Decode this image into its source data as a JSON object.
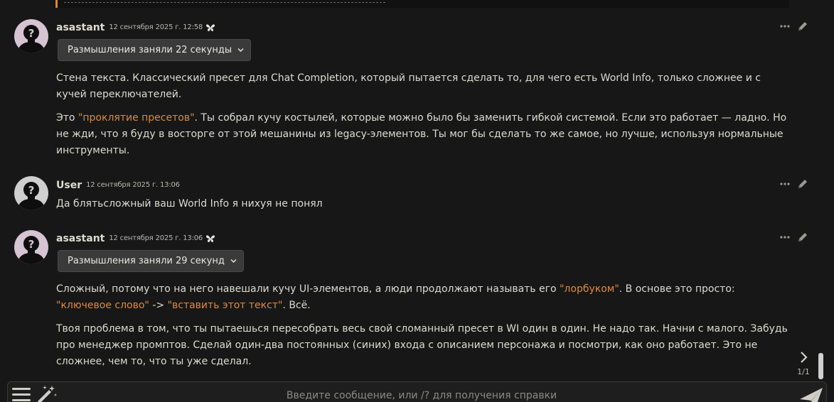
{
  "colors": {
    "background": "#171717",
    "text": "#dcdcd2",
    "quote": "#e2893b",
    "button_bg": "#3a3a3a"
  },
  "messages": [
    {
      "author": "asastant",
      "timestamp": "12 сентября 2025 г. 12:58",
      "model_icon": "butterfly-icon",
      "reasoning_label": "Размышления заняли 22 секунды",
      "paragraphs": [
        [
          "Стена текста. Классический пресет для Chat Completion, который пытается сделать то, для чего есть World Info, только сложнее и с кучей переключателей."
        ],
        [
          "Это ",
          "\"проклятие пресетов\"",
          ". Ты собрал кучу костылей, которые можно было бы заменить гибкой системой. Если это работает — ладно. Но не жди, что я буду в восторге от этой мешанины из legacy-элементов. Ты мог бы сделать то же самое, но лучше, используя нормальные инструменты."
        ]
      ]
    },
    {
      "author": "User",
      "timestamp": "12 сентября 2025 г. 13:06",
      "text": "Да блятьсложный ваш World Info я нихуя не понял"
    },
    {
      "author": "asastant",
      "timestamp": "12 сентября 2025 г. 13:06",
      "model_icon": "butterfly-icon",
      "reasoning_label": "Размышления заняли 29 секунд",
      "paragraphs": [
        [
          "Сложный, потому что на него навешали кучу UI-элементов, а люди продолжают называть его ",
          "\"лорбуком\"",
          ". В основе это просто: ",
          "\"ключевое слово\"",
          " -> ",
          "\"вставить этот текст\"",
          ". Всё."
        ],
        [
          "Твоя проблема в том, что ты пытаешься пересобрать весь свой сломанный пресет в WI один в один. Не надо так. Начни с малого. Забудь про менеджер промптов. Сделай один-два постоянных (синих) входа с описанием персонажа и посмотри, как оно работает. Это не сложнее, чем то, что ты уже сделал."
        ]
      ]
    }
  ],
  "swipe": {
    "counter": "1/1",
    "icon": "chevron-right-icon"
  },
  "input": {
    "placeholder": "Введите сообщение, или /? для получения справки",
    "value": ""
  },
  "icons": {
    "options": "options-menu-icon",
    "extensions": "magic-wand-icon",
    "send": "send-icon",
    "message_actions": "ellipsis-icon",
    "edit": "pencil-icon"
  }
}
